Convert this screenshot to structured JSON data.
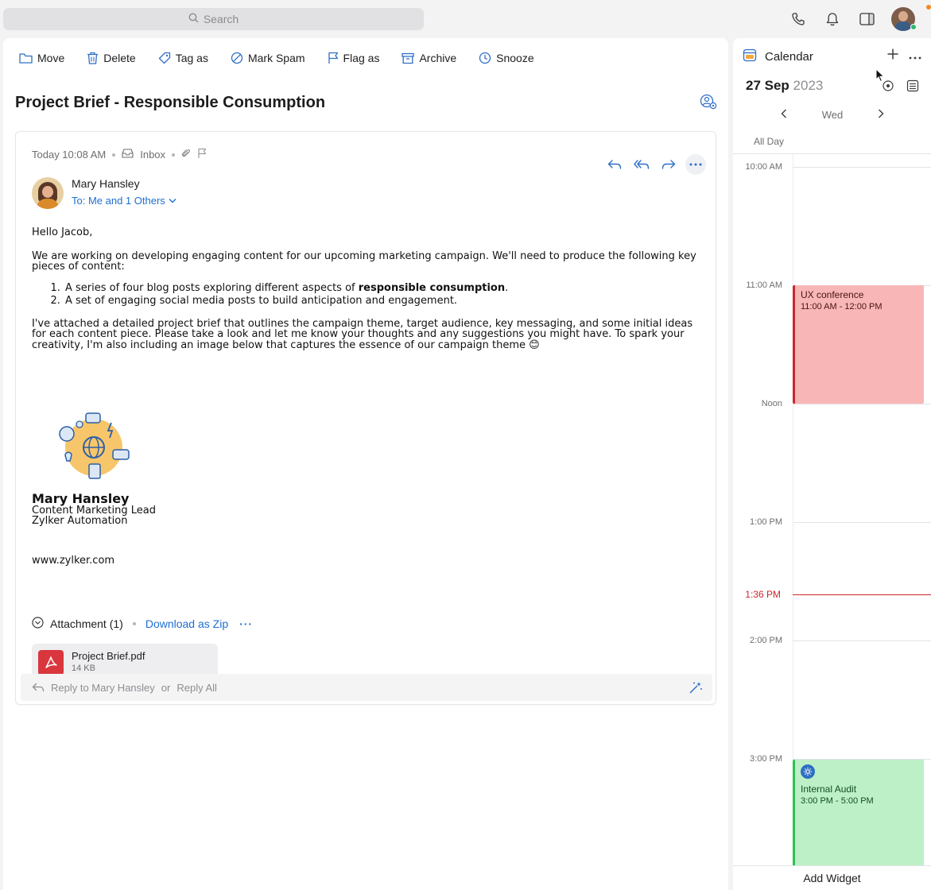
{
  "search": {
    "placeholder": "Search"
  },
  "topbar": {
    "icons": [
      "phone-icon",
      "bell-icon",
      "panel-toggle-icon",
      "user-avatar"
    ]
  },
  "toolbar": {
    "move": "Move",
    "delete": "Delete",
    "tag": "Tag as",
    "spam": "Mark Spam",
    "flag": "Flag as",
    "archive": "Archive",
    "snooze": "Snooze"
  },
  "email": {
    "subject": "Project Brief - Responsible Consumption",
    "time": "Today 10:08 AM",
    "folder": "Inbox",
    "sender": "Mary Hansley",
    "to": "To: Me and 1 Others",
    "greeting": "Hello Jacob,",
    "para1": "We are working on developing engaging content for our upcoming marketing campaign. We'll need to produce the following key pieces of content:",
    "list1_pre": "A series of four blog posts exploring different aspects of ",
    "list1_bold": "responsible consumption",
    "list1_post": ".",
    "list2": "A set of engaging social media posts to build anticipation and engagement.",
    "para2": "I've attached a detailed project brief that outlines the campaign theme, target audience, key messaging, and some initial ideas for each content piece. Please take a look and let me know your thoughts and any suggestions you might have. To spark your creativity, I'm also including an image below that captures the essence of our campaign theme 😊",
    "sig_name": "Mary Hansley",
    "sig_title": "Content Marketing Lead",
    "sig_company": "Zylker Automation",
    "sig_web": "www.zylker.com"
  },
  "attachments": {
    "title": "Attachment (1)",
    "download": "Download as Zip",
    "more": "···",
    "file_name": "Project Brief.pdf",
    "file_size": "14 KB"
  },
  "reply": {
    "reply_text": "Reply to Mary Hansley",
    "or": "or",
    "reply_all": "Reply All"
  },
  "calendar": {
    "title": "Calendar",
    "day_month": "27 Sep",
    "year": "2023",
    "weekday": "Wed",
    "all_day": "All Day",
    "hours": [
      "10:00 AM",
      "11:00 AM",
      "Noon",
      "1:00 PM",
      "2:00 PM",
      "3:00 PM"
    ],
    "now": "1:36 PM",
    "events": [
      {
        "title": "UX conference",
        "time": "11:00 AM - 12:00 PM",
        "color": "#f8b6b6"
      },
      {
        "title": "Internal Audit",
        "time": "3:00 PM - 5:00 PM",
        "color": "#bdf0c7"
      }
    ],
    "add_widget": "Add Widget"
  }
}
